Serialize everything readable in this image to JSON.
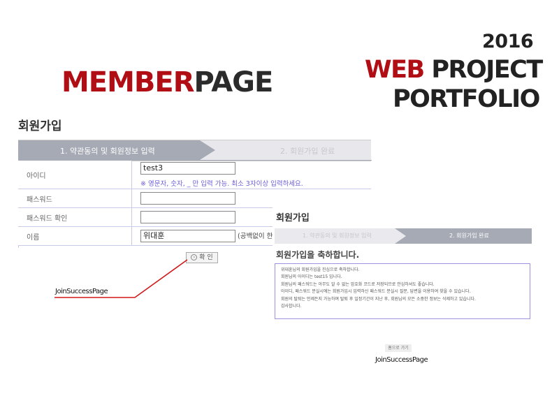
{
  "header": {
    "year": "2016",
    "project_red": "WEB",
    "project_rest": "PROJECT",
    "portfolio": "PORTFOLIO",
    "page_red": "MEMBER",
    "page_dark": "PAGE"
  },
  "signup": {
    "title": "회원가입",
    "step1": "1. 약관동의 및 회원정보 입력",
    "step2": "2. 회원가입 완료",
    "fields": {
      "id_label": "아이디",
      "id_value": "test3",
      "id_hint": "※ 영문자, 숫자, _ 만 입력 가능. 최소 3자이상 입력하세요.",
      "pw_label": "패스워드",
      "pw_value": "",
      "pw_confirm_label": "패스워드 확인",
      "pw_confirm_value": "",
      "name_label": "이름",
      "name_value": "위대훈",
      "name_note": "(공백없이 한글만 "
    },
    "confirm_button": "확 인"
  },
  "annotation_1": "JoinSuccessPage",
  "success": {
    "title": "회원가입",
    "step1": "1. 약관동의 및 회원정보 입력",
    "step2": "2. 회원가입 완료",
    "heading": "회원가입을 축하합니다.",
    "messages": [
      "위대훈님의 회원가입을 진심으로 축하합니다.",
      "회원님의 아이디는 test15 입니다.",
      "회원님의 패스워드는 아무도 알 수 없는 암호화 코드로 저장되므로 안심하셔도 좋습니다.",
      "아이디, 패스워드 분실시에는 회원가입시 입력하신 패스워드 분실시 질문, 답변을 이용하여 찾을 수 있습니다.",
      "회원의 탈퇴는 언제든지 가능하며 탈퇴 후 일정기간이 지난 후, 회원님의 모든 소중한 정보는 삭제하고 있습니다.",
      "감사합니다."
    ],
    "home_button": "홈으로 가기"
  },
  "annotation_2": "JoinSuccessPage",
  "colors": {
    "accent_red": "#b00e14",
    "step_active": "#a6aab4",
    "border": "#c9c9e8",
    "hint": "#6b5cd9"
  }
}
